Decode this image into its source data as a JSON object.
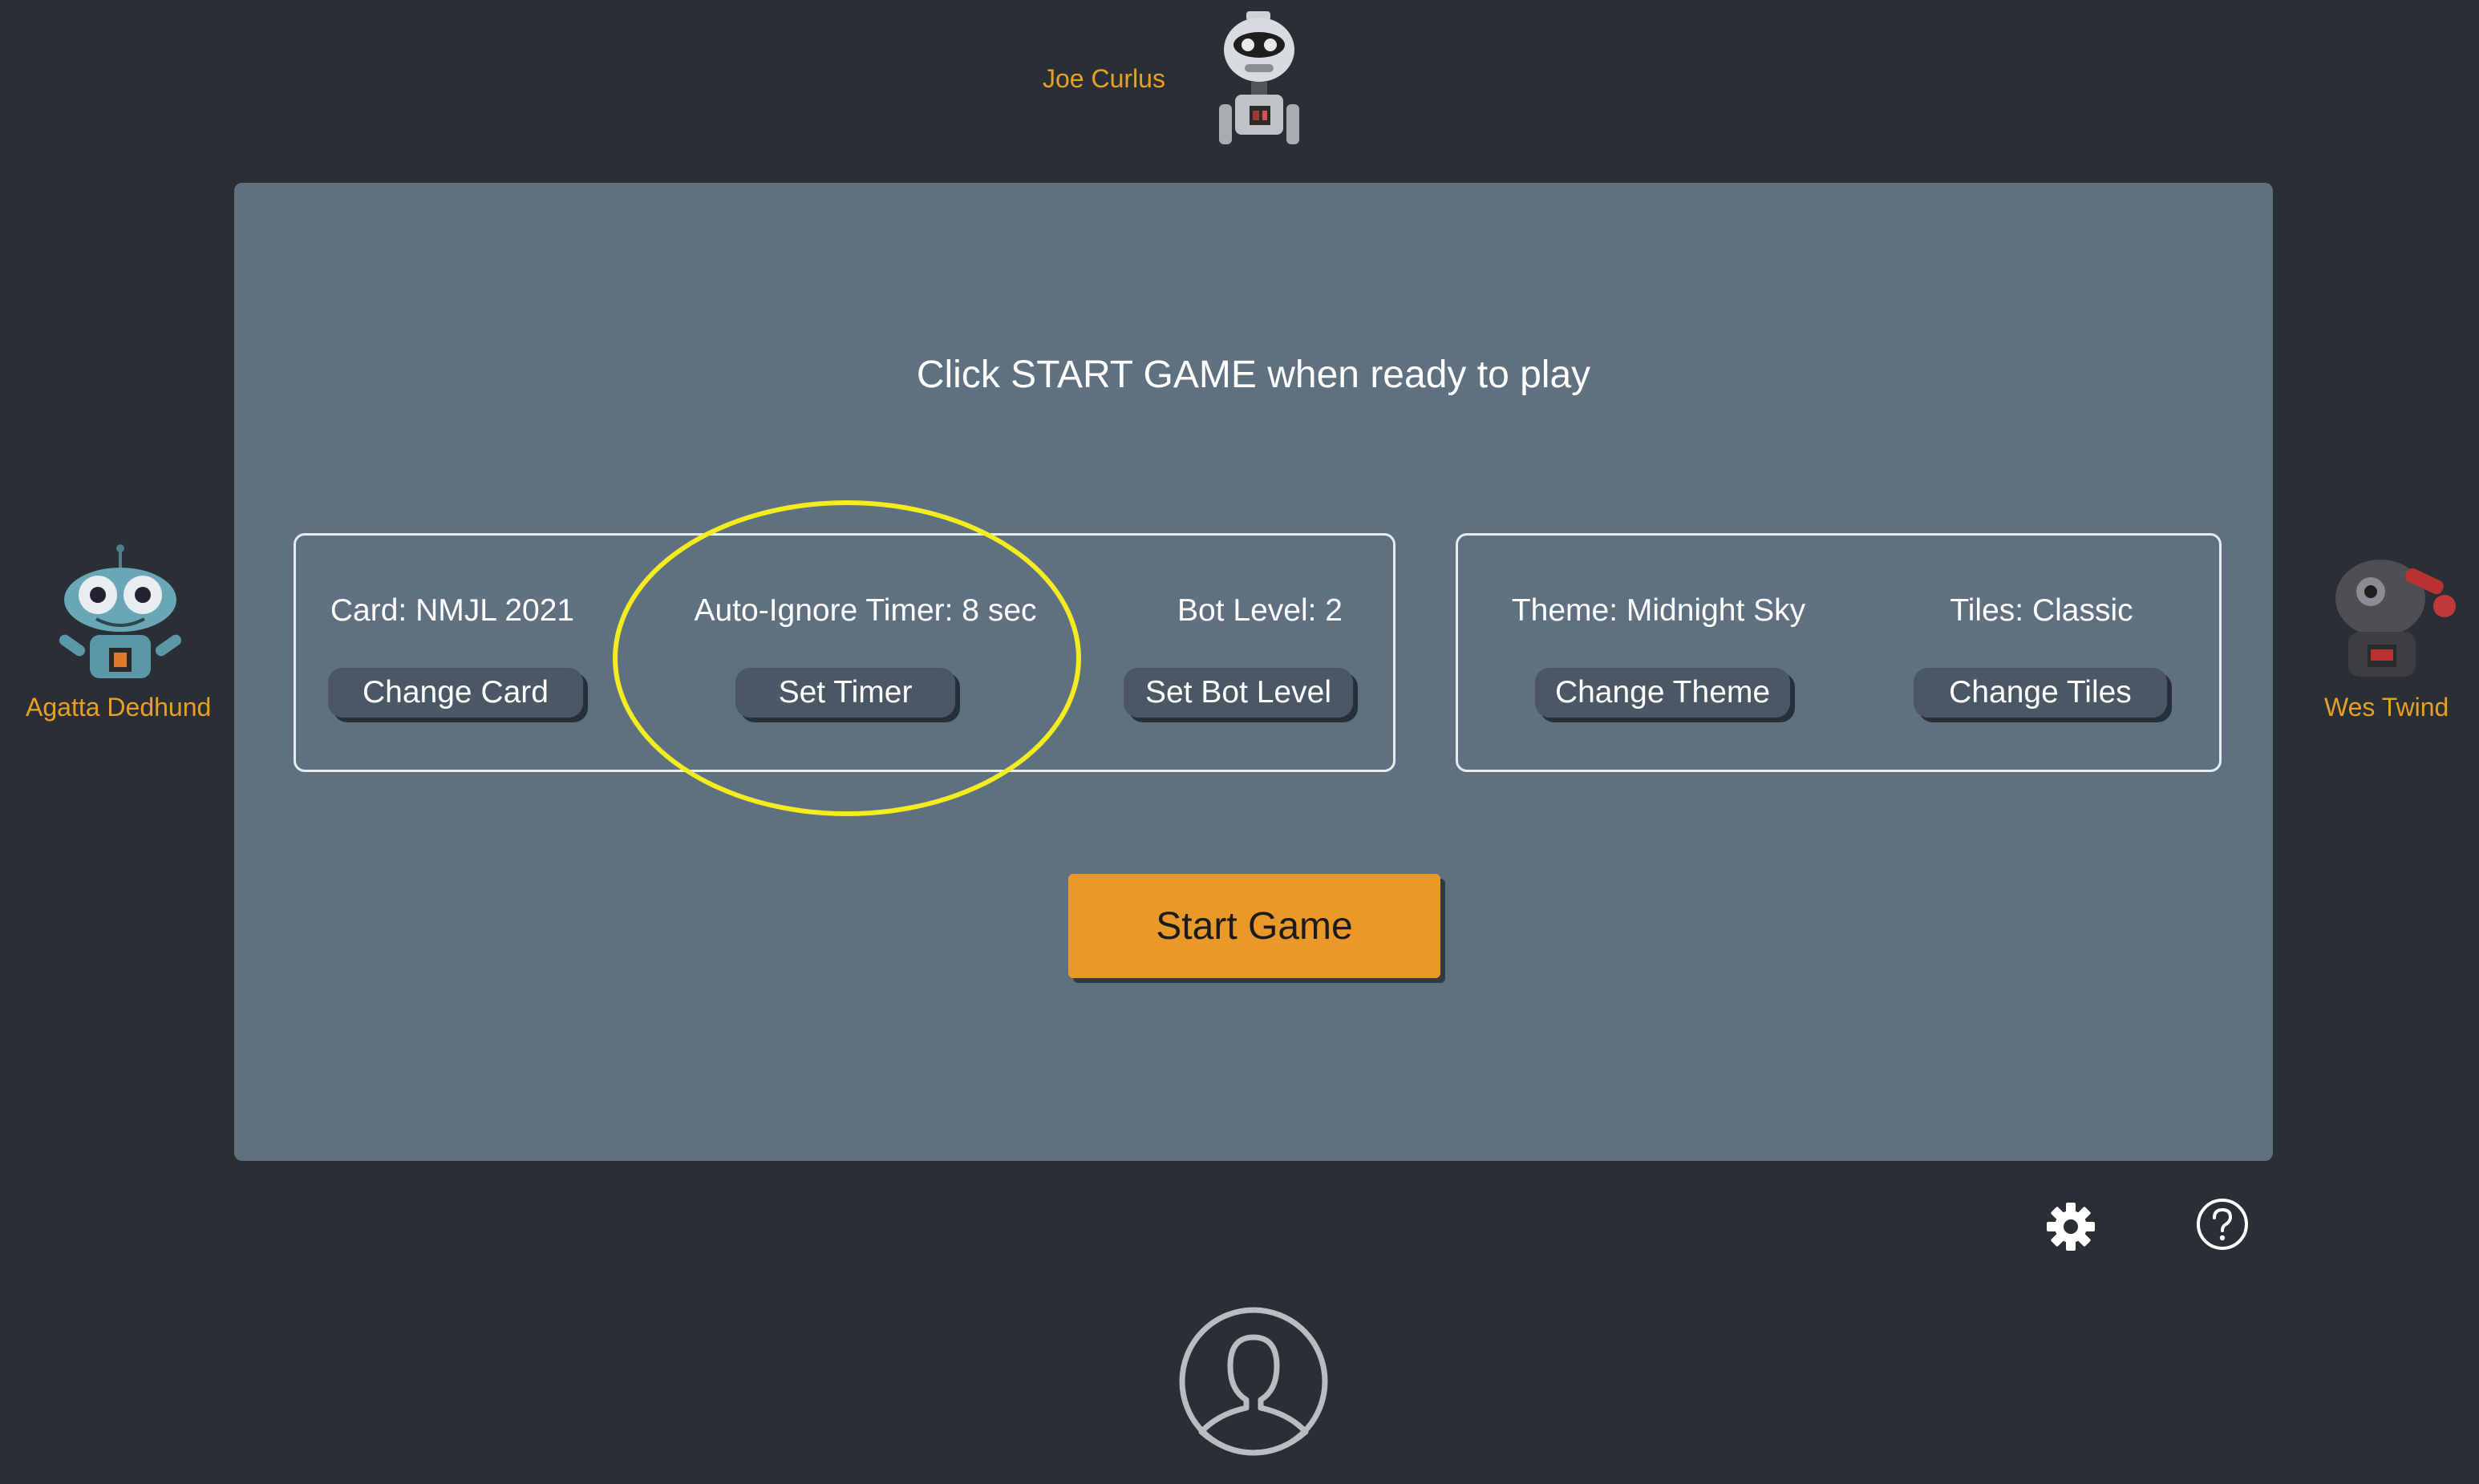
{
  "players": {
    "top": {
      "name": "Joe Curlus"
    },
    "left": {
      "name": "Agatta Dedhund"
    },
    "right": {
      "name": "Wes Twind"
    }
  },
  "panel": {
    "prompt": "Click START GAME when ready to play",
    "game_settings": {
      "card": {
        "label": "Card: NMJL 2021",
        "button": "Change Card"
      },
      "timer": {
        "label": "Auto-Ignore Timer: 8 sec",
        "button": "Set Timer"
      },
      "bot_level": {
        "label": "Bot Level: 2",
        "button": "Set Bot Level"
      }
    },
    "appearance_settings": {
      "theme": {
        "label": "Theme: Midnight Sky",
        "button": "Change Theme"
      },
      "tiles": {
        "label": "Tiles: Classic",
        "button": "Change Tiles"
      }
    },
    "start_button": "Start Game"
  },
  "icons": {
    "settings": "gear-icon",
    "help": "help-icon",
    "user": "user-avatar-icon"
  },
  "colors": {
    "background": "#2a2f36",
    "panel": "#5f7180",
    "player_name": "#e8a024",
    "start_button": "#e8992a",
    "highlight": "#f3ec1f"
  }
}
